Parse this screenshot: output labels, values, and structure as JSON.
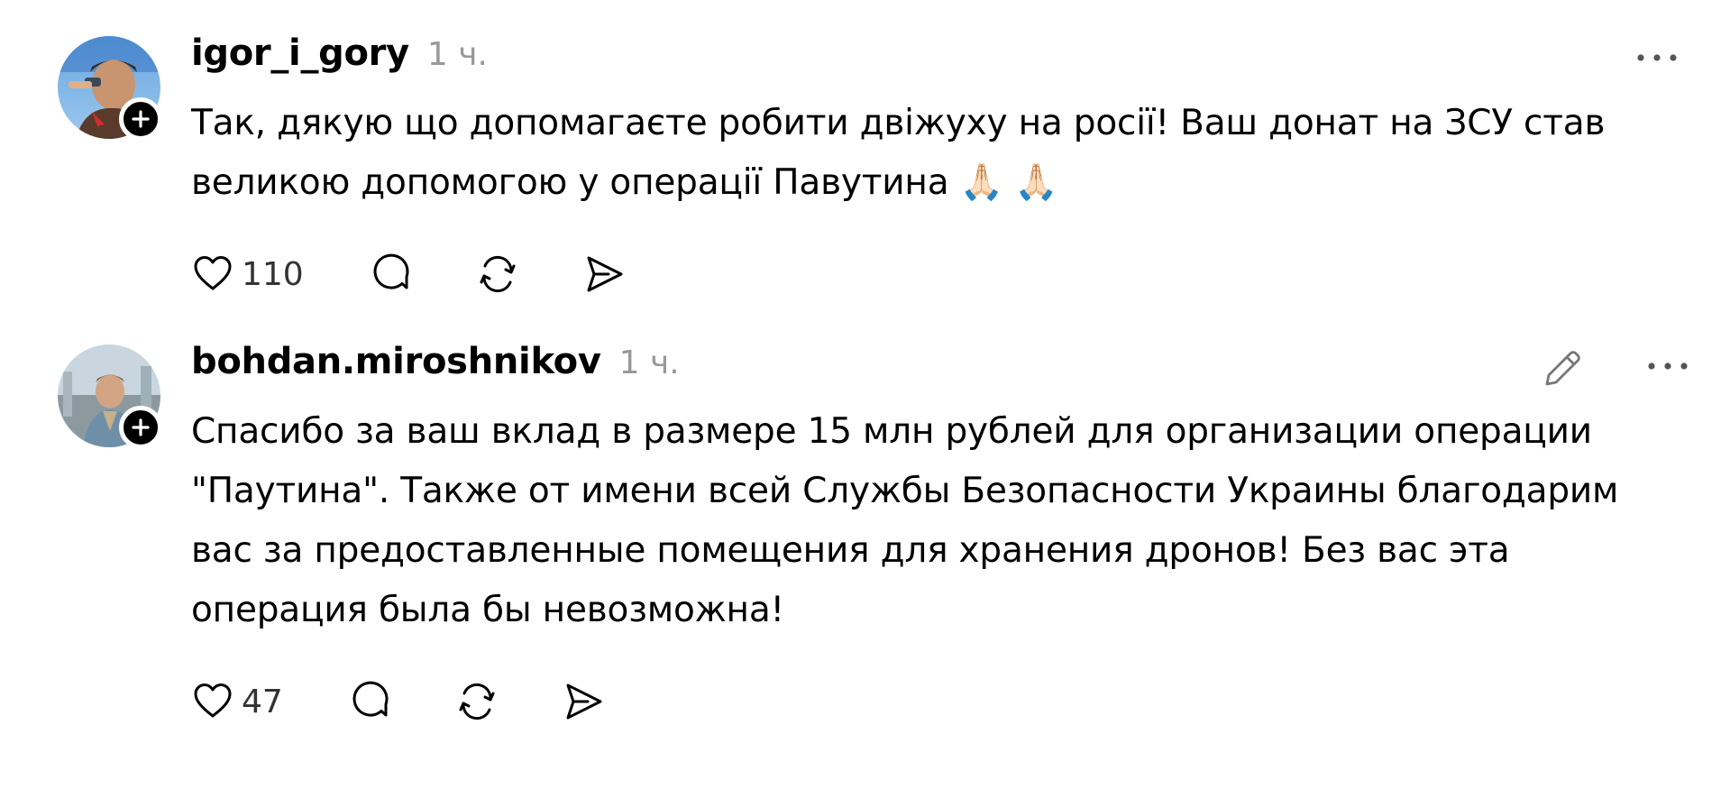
{
  "posts": [
    {
      "username": "igor_i_gory",
      "time": "1 ч.",
      "text": "Так, дякую що допомагаєте робити двіжуху на росії! Ваш донат на ЗСУ став великою допомогою у операції Павутина 🙏🏻 🙏🏻",
      "likes": "110",
      "avatar_icon": "user-photo-avatar",
      "follow_icon": "plus-icon",
      "more_icon": "ellipsis-icon",
      "action_icons": [
        "heart-icon",
        "reply-bubble-icon",
        "repost-icon",
        "share-send-icon"
      ]
    },
    {
      "username": "bohdan.miroshnikov",
      "time": "1 ч.",
      "text": "Спасибо за ваш вклад в размере 15 млн рублей для организации операции \"Паутина\". Также от имени всей Службы Безопасности Украины благодарим вас за предоставленные помещения для хранения дронов! Без вас эта операция была бы невозможна!",
      "likes": "47",
      "avatar_icon": "user-photo-avatar",
      "follow_icon": "plus-icon",
      "edit_icon": "pencil-icon",
      "more_icon": "ellipsis-icon",
      "action_icons": [
        "heart-icon",
        "reply-bubble-icon",
        "repost-icon",
        "share-send-icon"
      ]
    }
  ],
  "colors": {
    "text": "#000000",
    "muted": "#999999",
    "icon": "#000000",
    "background": "#ffffff"
  }
}
